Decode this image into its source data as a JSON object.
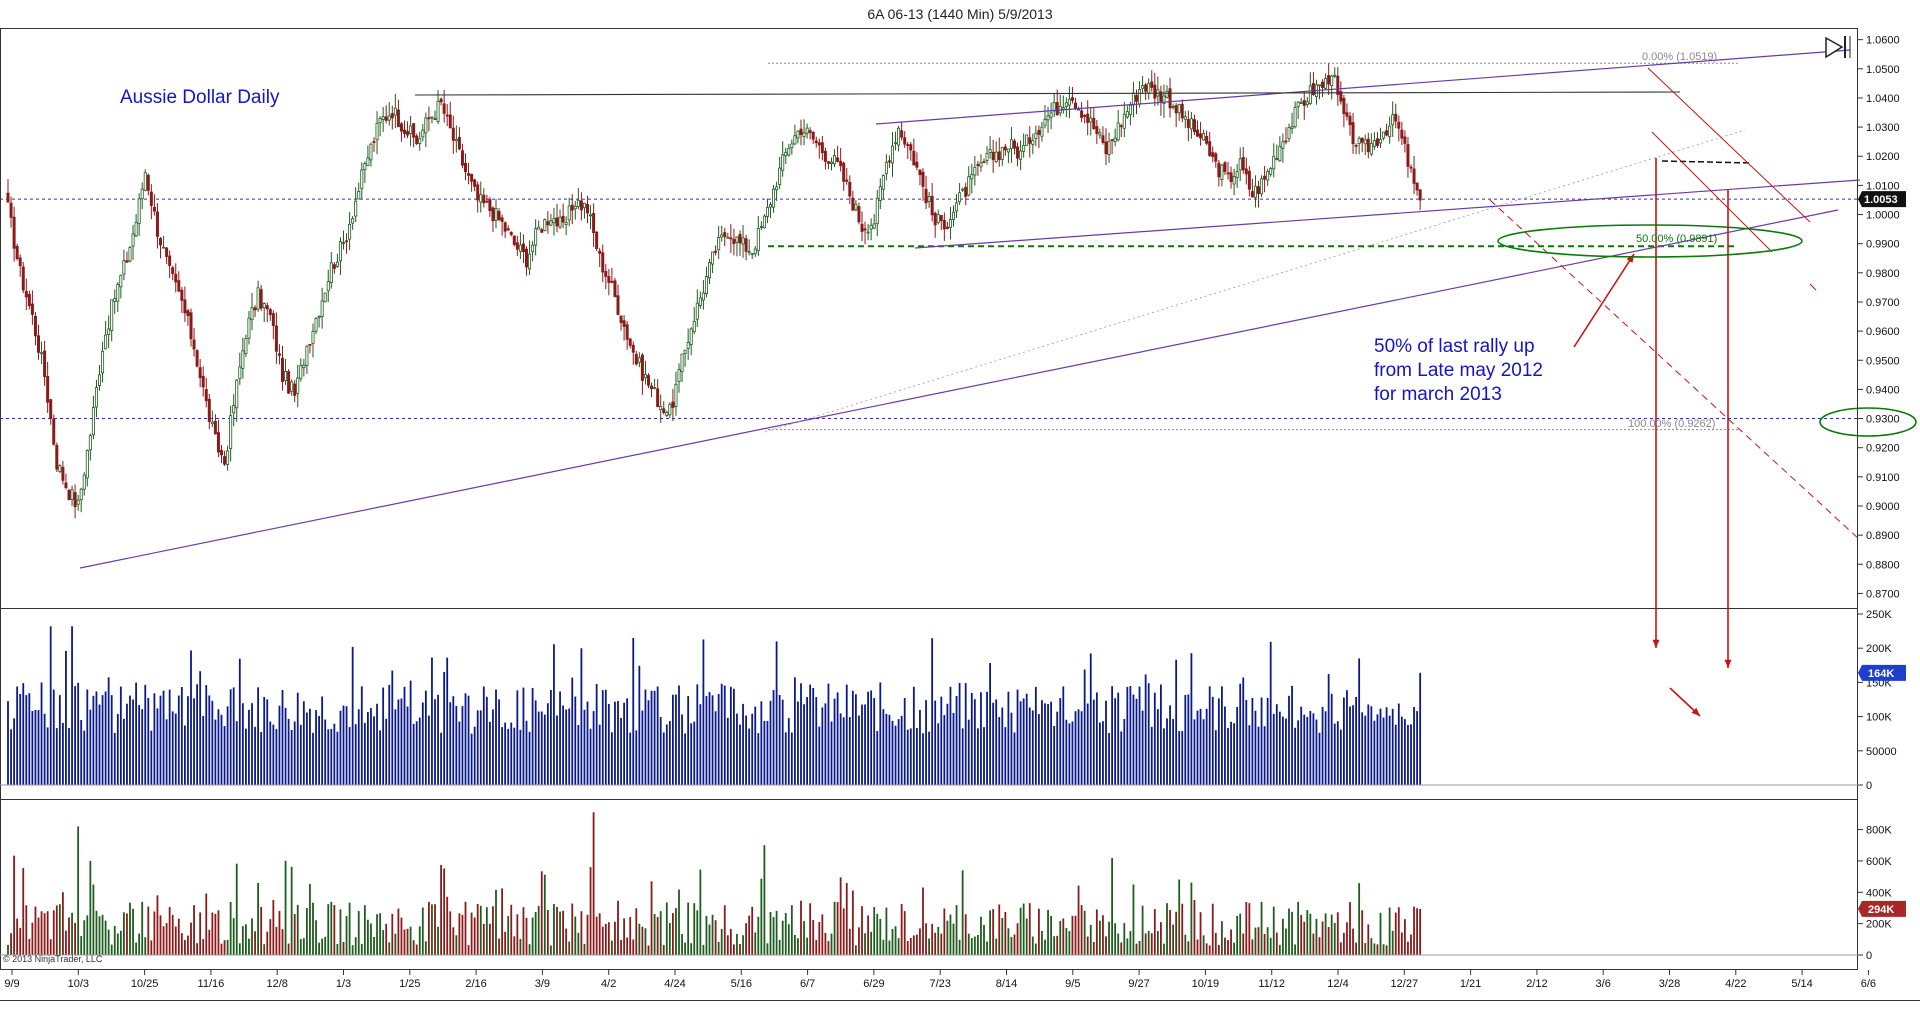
{
  "window": {
    "title": "6A 06-13 (1440 Min)  5/9/2013"
  },
  "colors": {
    "candle_up": "#1e5d1e",
    "candle_down": "#8b1a1a",
    "volume": "#0b1a8a",
    "trend_line": "#6a3aa8",
    "fib_green": "#0a7a0a",
    "annotation_red": "#c81414",
    "label_blue": "#1414c8",
    "price_tag_bg": "#111111",
    "volume_tag_bg": "#1e3ed0",
    "indicator_tag_bg": "#a82828"
  },
  "chart_data": [
    {
      "type": "candlestick",
      "title": "Aussie Dollar Daily",
      "y_ticks": [
        "1.0600",
        "1.0500",
        "1.0400",
        "1.0300",
        "1.0200",
        "1.0100",
        "1.0000",
        "0.9900",
        "0.9800",
        "0.9700",
        "0.9600",
        "0.9500",
        "0.9400",
        "0.9300",
        "0.9200",
        "0.9100",
        "0.9000",
        "0.8900",
        "0.8800",
        "0.8700"
      ],
      "ylim": [
        0.865,
        1.064
      ],
      "current_price": "1.0053",
      "fib_levels": [
        {
          "label": "0.00% (1.0519)",
          "value": 1.0519
        },
        {
          "label": "50.00% (0.9891)",
          "value": 0.9891
        },
        {
          "label": "100.00% (0.9262)",
          "value": 0.9262
        }
      ],
      "annotation": [
        "50% of last rally up",
        "from Late may 2012",
        "for march 2013"
      ],
      "close_path": [
        [
          0,
          1.002
        ],
        [
          4,
          0.98
        ],
        [
          8,
          0.965
        ],
        [
          12,
          0.945
        ],
        [
          16,
          0.915
        ],
        [
          20,
          0.905
        ],
        [
          23,
          0.9
        ],
        [
          27,
          0.925
        ],
        [
          31,
          0.955
        ],
        [
          35,
          0.972
        ],
        [
          39,
          0.985
        ],
        [
          42,
          0.998
        ],
        [
          45,
          1.015
        ],
        [
          49,
          0.995
        ],
        [
          53,
          0.98
        ],
        [
          57,
          0.97
        ],
        [
          61,
          0.955
        ],
        [
          65,
          0.935
        ],
        [
          68,
          0.922
        ],
        [
          71,
          0.915
        ],
        [
          74,
          0.935
        ],
        [
          78,
          0.96
        ],
        [
          82,
          0.972
        ],
        [
          86,
          0.965
        ],
        [
          90,
          0.945
        ],
        [
          94,
          0.938
        ],
        [
          98,
          0.955
        ],
        [
          102,
          0.968
        ],
        [
          106,
          0.982
        ],
        [
          110,
          0.99
        ],
        [
          114,
          1.005
        ],
        [
          118,
          1.02
        ],
        [
          122,
          1.032
        ],
        [
          126,
          1.036
        ],
        [
          130,
          1.03
        ],
        [
          134,
          1.025
        ],
        [
          138,
          1.033
        ],
        [
          142,
          1.038
        ],
        [
          146,
          1.026
        ],
        [
          150,
          1.015
        ],
        [
          154,
          1.005
        ],
        [
          158,
          1.002
        ],
        [
          162,
          0.997
        ],
        [
          166,
          0.99
        ],
        [
          170,
          0.985
        ],
        [
          174,
          0.995
        ],
        [
          178,
          1.0
        ],
        [
          182,
          0.995
        ],
        [
          186,
          1.005
        ],
        [
          190,
          1.002
        ],
        [
          194,
          0.985
        ],
        [
          198,
          0.975
        ],
        [
          202,
          0.962
        ],
        [
          206,
          0.95
        ],
        [
          210,
          0.942
        ],
        [
          214,
          0.935
        ],
        [
          217,
          0.932
        ],
        [
          220,
          0.945
        ],
        [
          224,
          0.962
        ],
        [
          228,
          0.975
        ],
        [
          232,
          0.988
        ],
        [
          236,
          0.995
        ],
        [
          240,
          0.99
        ],
        [
          244,
          0.988
        ],
        [
          248,
          0.998
        ],
        [
          252,
          1.012
        ],
        [
          256,
          1.024
        ],
        [
          260,
          1.03
        ],
        [
          264,
          1.026
        ],
        [
          268,
          1.021
        ],
        [
          272,
          1.017
        ],
        [
          276,
          1.007
        ],
        [
          280,
          0.996
        ],
        [
          284,
          0.998
        ],
        [
          288,
          1.018
        ],
        [
          292,
          1.03
        ],
        [
          296,
          1.022
        ],
        [
          300,
          1.01
        ],
        [
          304,
          0.997
        ],
        [
          308,
          0.998
        ],
        [
          312,
          1.005
        ],
        [
          316,
          1.012
        ],
        [
          320,
          1.018
        ],
        [
          324,
          1.021
        ],
        [
          328,
          1.024
        ],
        [
          332,
          1.021
        ],
        [
          336,
          1.028
        ],
        [
          340,
          1.033
        ],
        [
          344,
          1.037
        ],
        [
          348,
          1.042
        ],
        [
          352,
          1.036
        ],
        [
          356,
          1.03
        ],
        [
          360,
          1.022
        ],
        [
          364,
          1.03
        ],
        [
          368,
          1.038
        ],
        [
          372,
          1.045
        ],
        [
          376,
          1.042
        ],
        [
          380,
          1.041
        ],
        [
          384,
          1.035
        ],
        [
          388,
          1.03
        ],
        [
          392,
          1.025
        ],
        [
          396,
          1.017
        ],
        [
          400,
          1.012
        ],
        [
          404,
          1.017
        ],
        [
          408,
          1.007
        ],
        [
          412,
          1.012
        ],
        [
          416,
          1.022
        ],
        [
          420,
          1.03
        ],
        [
          424,
          1.038
        ],
        [
          428,
          1.043
        ],
        [
          432,
          1.045
        ],
        [
          434,
          1.05
        ],
        [
          436,
          1.04
        ],
        [
          440,
          1.028
        ],
        [
          444,
          1.022
        ],
        [
          448,
          1.025
        ],
        [
          452,
          1.03
        ],
        [
          455,
          1.032
        ],
        [
          458,
          1.022
        ],
        [
          461,
          1.01
        ],
        [
          463,
          1.005
        ]
      ]
    },
    {
      "type": "bar",
      "ylabel": "",
      "y_ticks": [
        "250K",
        "200K",
        "150K",
        "100K",
        "50000",
        "0"
      ],
      "ylim": [
        0,
        250000
      ],
      "current_value": "164K"
    },
    {
      "type": "bar",
      "ylabel": "",
      "y_ticks": [
        "800K",
        "600K",
        "400K",
        "200K",
        "0"
      ],
      "ylim": [
        0,
        950000
      ],
      "current_value": "294K"
    }
  ],
  "x_axis": {
    "labels": [
      "9/9",
      "10/3",
      "10/25",
      "11/16",
      "12/8",
      "1/3",
      "1/25",
      "2/16",
      "3/9",
      "4/2",
      "4/24",
      "5/16",
      "6/7",
      "6/29",
      "7/23",
      "8/14",
      "9/5",
      "9/27",
      "10/19",
      "11/12",
      "12/4",
      "12/27",
      "1/21",
      "2/12",
      "3/6",
      "3/28",
      "4/22",
      "5/14",
      "6/6"
    ]
  },
  "footer": {
    "copyright": "© 2013 NinjaTrader, LLC"
  }
}
